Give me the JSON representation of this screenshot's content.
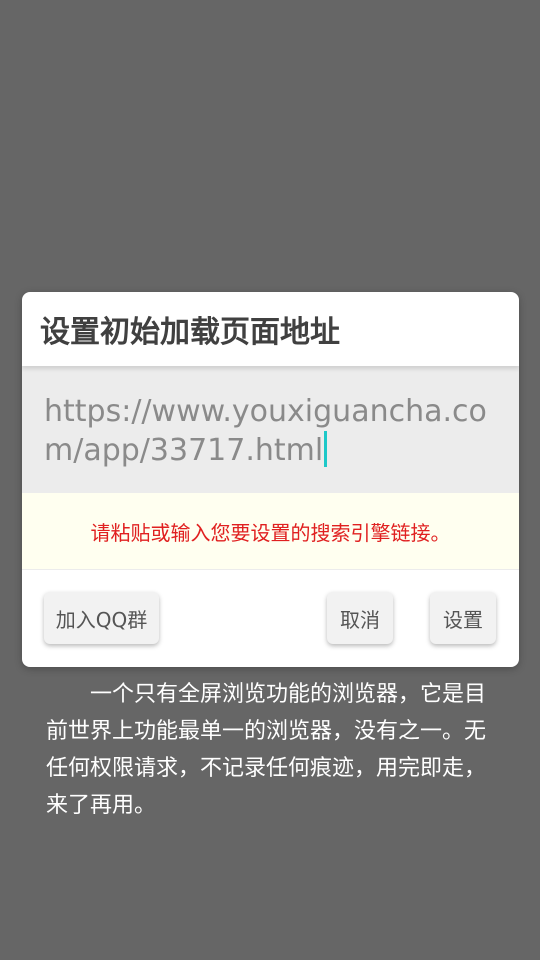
{
  "background": {
    "description_text": "一个只有全屏浏览功能的浏览器，它是目前世界上功能最单一的浏览器，没有之一。无任何权限请求，不记录任何痕迹，用完即走，来了再用。"
  },
  "dialog": {
    "title": "设置初始加载页面地址",
    "url_value": "https://www.youxiguancha.com/app/33717.html",
    "hint": "请粘贴或输入您要设置的搜索引擎链接。",
    "buttons": {
      "join_qq": "加入QQ群",
      "cancel": "取消",
      "confirm": "设置"
    }
  },
  "colors": {
    "overlay": "#666666",
    "hint_text": "#e02020",
    "caret": "#1ec8c8"
  }
}
